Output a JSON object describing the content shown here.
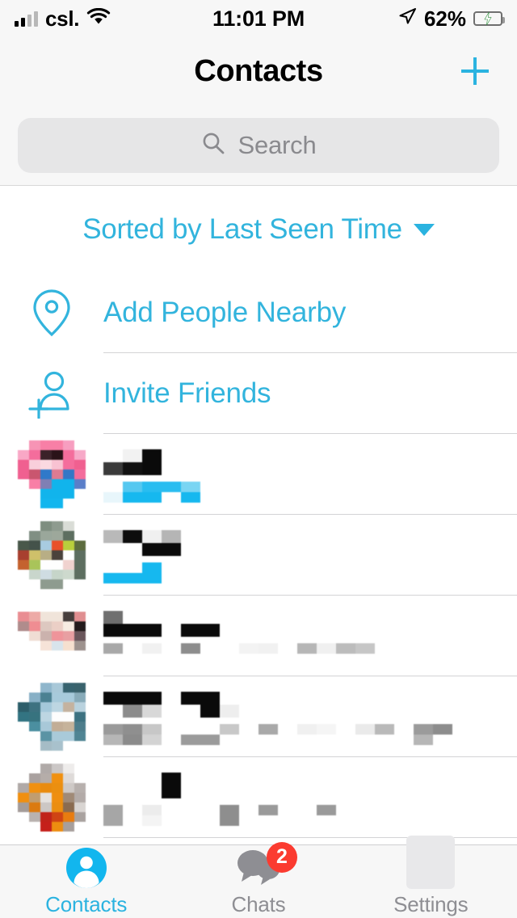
{
  "status_bar": {
    "carrier": "csl.",
    "wifi_icon": "wifi-icon",
    "time": "11:01 PM",
    "location_icon": "location-arrow-icon",
    "battery_percent": "62%",
    "battery_icon": "battery-charging-icon",
    "signal_icon": "cellular-signal-icon",
    "battery_fill_pct": 62
  },
  "nav": {
    "title": "Contacts",
    "add_icon": "plus-icon"
  },
  "search": {
    "placeholder": "Search",
    "icon": "search-icon",
    "value": ""
  },
  "sort": {
    "label": "Sorted by Last Seen Time",
    "caret_icon": "chevron-down-icon"
  },
  "actions": [
    {
      "label": "Add People Nearby",
      "icon": "location-pin-icon",
      "name": "add-people-nearby"
    },
    {
      "label": "Invite Friends",
      "icon": "person-add-icon",
      "name": "invite-friends"
    }
  ],
  "contacts": [
    {
      "name_redacted": true,
      "status_redacted": true,
      "status_online": true,
      "avatar_colors": [
        "#ffffff",
        "#f794b5",
        "#f87fa6",
        "#f87fa6",
        "#f79ec0",
        "#ffffff",
        "#f9a8c6",
        "#f46d9c",
        "#3b2229",
        "#2a1318",
        "#f46d9c",
        "#f7a9c8",
        "#f06090",
        "#f9cfdb",
        "#fbd9e1",
        "#f8c2d2",
        "#f46d9c",
        "#f06090",
        "#f06090",
        "#c9566f",
        "#2f79c9",
        "#dd7b92",
        "#3377c6",
        "#f46d9c",
        "#ffffff",
        "#f87fa6",
        "#7f7fb4",
        "#11b4ec",
        "#11b4ec",
        "#5a7ec9",
        "#ffffff",
        "#ffffff",
        "#11b4ec",
        "#11b4ec",
        "#11b4ec",
        "#ffffff",
        "#ffffff",
        "#ffffff",
        "#12b6ee",
        "#12b6ee",
        "#ffffff",
        "#ffffff"
      ]
    },
    {
      "name_redacted": true,
      "status_redacted": true,
      "status_online": true,
      "avatar_colors": [
        "#ffffff",
        "#ffffff",
        "#7e8e80",
        "#8e9b8f",
        "#d9dcd6",
        "#ffffff",
        "#ffffff",
        "#808f83",
        "#9aa79b",
        "#9da89b",
        "#5d6e60",
        "#ffffff",
        "#49584a",
        "#44524a",
        "#a8cbe0",
        "#e8502b",
        "#b9cf3c",
        "#5c6c3e",
        "#a83f2f",
        "#cfc06a",
        "#b8ae85",
        "#4a423c",
        "#fefefe",
        "#5d6e60",
        "#c4622f",
        "#a9c45a",
        "#fefefe",
        "#fefefe",
        "#f0d2cf",
        "#5d6e60",
        "#ffffff",
        "#c9d6cc",
        "#cfdce2",
        "#c6d5c9",
        "#cdd9cd",
        "#5d6e60",
        "#ffffff",
        "#ffffff",
        "#8e9b8f",
        "#8e9b8f",
        "#ffffff",
        "#ffffff"
      ]
    },
    {
      "name_redacted": true,
      "status_redacted": true,
      "status_online": false,
      "avatar_colors": [
        "#ffffff",
        "#ffffff",
        "#ffffff",
        "#ffffff",
        "#ffffff",
        "#ffffff",
        "#e98d92",
        "#edaaa6",
        "#f0e4da",
        "#f0e4da",
        "#463e3c",
        "#e08e90",
        "#b08c8c",
        "#ef8d92",
        "#ddc8c0",
        "#ebcfc6",
        "#f7ece2",
        "#231b1c",
        "#ffffff",
        "#f0ddd4",
        "#cbb2ad",
        "#ef949a",
        "#e89fa2",
        "#6a565b",
        "#ffffff",
        "#ffffff",
        "#f6e3d8",
        "#d8e4ec",
        "#f6e0cf",
        "#9d928e",
        "#ffffff",
        "#ffffff",
        "#ffffff",
        "#ffffff",
        "#ffffff",
        "#ffffff",
        "#ffffff",
        "#ffffff",
        "#ffffff",
        "#ffffff",
        "#ffffff",
        "#ffffff"
      ]
    },
    {
      "name_redacted": true,
      "status_redacted": true,
      "status_online": false,
      "avatar_colors": [
        "#ffffff",
        "#ffffff",
        "#8fb6cc",
        "#a8c8d8",
        "#37636f",
        "#39626c",
        "#ffffff",
        "#88b0c6",
        "#4b8192",
        "#a7cadb",
        "#a7cadb",
        "#88abb9",
        "#2d5e6a",
        "#3d7180",
        "#a4c8da",
        "#bdd6e2",
        "#c4b29f",
        "#b9d2de",
        "#337482",
        "#37737f",
        "#bdd6e2",
        "#fdfdfd",
        "#fdfdfd",
        "#3c7180",
        "#ffffff",
        "#4b8fa0",
        "#a8c8d8",
        "#c2ad96",
        "#c6b39b",
        "#4d7d8b",
        "#ffffff",
        "#ffffff",
        "#5b93a4",
        "#a9cad9",
        "#a9cad9",
        "#4f8493",
        "#ffffff",
        "#ffffff",
        "#a5bcc6",
        "#a8c1cc",
        "#ffffff",
        "#ffffff"
      ]
    },
    {
      "name_redacted": true,
      "status_redacted": true,
      "status_online": false,
      "avatar_colors": [
        "#ffffff",
        "#ffffff",
        "#b0aaa8",
        "#cbc7c6",
        "#eeeceb",
        "#ffffff",
        "#ffffff",
        "#a9a19f",
        "#b5ada9",
        "#f09010",
        "#dedad8",
        "#ffffff",
        "#b0a9a7",
        "#f09010",
        "#e98b0f",
        "#eb8f10",
        "#cec9c6",
        "#b7b0ad",
        "#f08f10",
        "#c19d6f",
        "#e5e2df",
        "#ef8f10",
        "#a08a77",
        "#b3aba8",
        "#a49c99",
        "#db7a10",
        "#ccc7c4",
        "#eb8e10",
        "#8a6b50",
        "#d9d5d2",
        "#ffffff",
        "#b9b2af",
        "#c0231a",
        "#cf4414",
        "#e87c10",
        "#a9a29f",
        "#ffffff",
        "#ffffff",
        "#c5201a",
        "#ed8d10",
        "#a79f9c",
        "#ffffff"
      ]
    }
  ],
  "tabs": [
    {
      "label": "Contacts",
      "icon": "person-circle-icon",
      "active": true,
      "badge": null
    },
    {
      "label": "Chats",
      "icon": "chat-bubbles-icon",
      "active": false,
      "badge": "2"
    },
    {
      "label": "Settings",
      "icon": "settings-placeholder-icon",
      "active": false,
      "badge": null
    }
  ],
  "colors": {
    "accent": "#2bb3e0",
    "badge": "#fb3b30",
    "inactive": "#8e8e93",
    "bar_bg": "#f7f7f7",
    "search_bg": "#e6e6e7",
    "separator": "#d3d3d5"
  }
}
